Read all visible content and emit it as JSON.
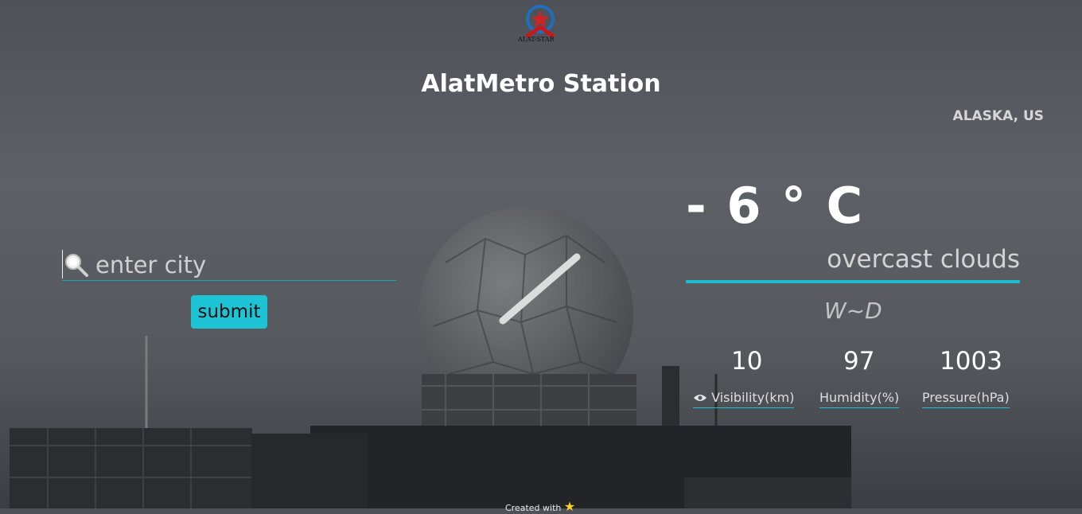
{
  "header": {
    "logo_text": "ALAT-STAR",
    "title": "AlatMetro Station",
    "location": "ALASKA, US"
  },
  "search": {
    "placeholder": "enter city",
    "value": "",
    "submit_label": "submit",
    "icon": "magnifier-icon"
  },
  "weather": {
    "temperature": "- 6 ° C",
    "description": "overcast clouds",
    "wind_direction": "W~D",
    "stats": [
      {
        "value": "10",
        "label": "Visibility(km)",
        "icon": "eye-icon"
      },
      {
        "value": "97",
        "label": "Humidity(%)"
      },
      {
        "value": "1003",
        "label": "Pressure(hPa)"
      }
    ]
  },
  "footer": {
    "text": "Created with",
    "icon": "star-icon"
  },
  "colors": {
    "accent": "#1fbdd0",
    "button": "#1fc3d6",
    "text": "#ffffff"
  }
}
